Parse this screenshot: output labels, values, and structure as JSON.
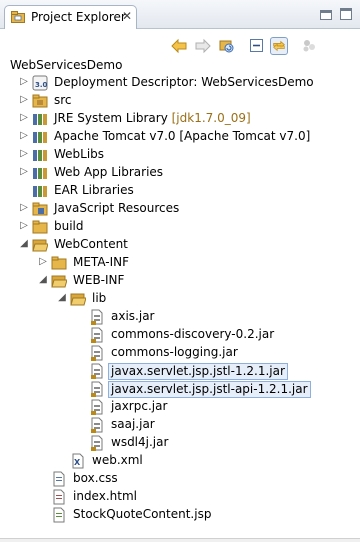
{
  "view": {
    "tab_title": "Project Explorer",
    "close_glyph": "✕",
    "project_name": "WebServicesDemo"
  },
  "icons": {
    "view": "project-explorer-icon",
    "back": "back-arrow-icon",
    "forward": "forward-arrow-icon",
    "refresh": "refresh-icon",
    "collapse": "collapse-all-icon",
    "link": "link-with-editor-icon",
    "menu": "view-menu-icon"
  },
  "colors": {
    "selection_bg": "#e6eefa",
    "selection_border": "#8fb0dd",
    "jre_decoration": "#9b6f16",
    "folder": "#e7b64a",
    "jar": "#7a7a7a"
  },
  "tree": [
    {
      "label": "Deployment Descriptor: WebServicesDemo",
      "icon": "deployment-descriptor-icon",
      "twisty": "collapsed"
    },
    {
      "label": "src",
      "icon": "source-folder-icon",
      "twisty": "collapsed"
    },
    {
      "label": "JRE System Library",
      "decoration": "[jdk1.7.0_09]",
      "icon": "library-icon",
      "twisty": "collapsed"
    },
    {
      "label": "Apache Tomcat v7.0 [Apache Tomcat v7.0]",
      "icon": "library-icon",
      "twisty": "collapsed"
    },
    {
      "label": "WebLibs",
      "icon": "library-icon",
      "twisty": "collapsed"
    },
    {
      "label": "Web App Libraries",
      "icon": "library-icon",
      "twisty": "collapsed"
    },
    {
      "label": "EAR Libraries",
      "icon": "library-icon",
      "twisty": "none"
    },
    {
      "label": "JavaScript Resources",
      "icon": "javascript-resources-icon",
      "twisty": "collapsed"
    },
    {
      "label": "build",
      "icon": "folder-icon",
      "twisty": "collapsed"
    },
    {
      "label": "WebContent",
      "icon": "folder-open-icon",
      "twisty": "expanded"
    },
    {
      "label": "META-INF",
      "icon": "folder-icon",
      "twisty": "collapsed"
    },
    {
      "label": "WEB-INF",
      "icon": "folder-open-icon",
      "twisty": "expanded"
    },
    {
      "label": "lib",
      "icon": "folder-open-icon",
      "twisty": "expanded"
    },
    {
      "label": "axis.jar",
      "icon": "jar-icon"
    },
    {
      "label": "commons-discovery-0.2.jar",
      "icon": "jar-icon"
    },
    {
      "label": "commons-logging.jar",
      "icon": "jar-icon"
    },
    {
      "label": "javax.servlet.jsp.jstl-1.2.1.jar",
      "icon": "jar-icon",
      "selected": true
    },
    {
      "label": "javax.servlet.jsp.jstl-api-1.2.1.jar",
      "icon": "jar-icon",
      "selected": true
    },
    {
      "label": "jaxrpc.jar",
      "icon": "jar-icon"
    },
    {
      "label": "saaj.jar",
      "icon": "jar-icon"
    },
    {
      "label": "wsdl4j.jar",
      "icon": "jar-icon"
    },
    {
      "label": "web.xml",
      "icon": "xml-file-icon"
    },
    {
      "label": "box.css",
      "icon": "css-file-icon"
    },
    {
      "label": "index.html",
      "icon": "html-file-icon"
    },
    {
      "label": "StockQuoteContent.jsp",
      "icon": "jsp-file-icon"
    }
  ]
}
